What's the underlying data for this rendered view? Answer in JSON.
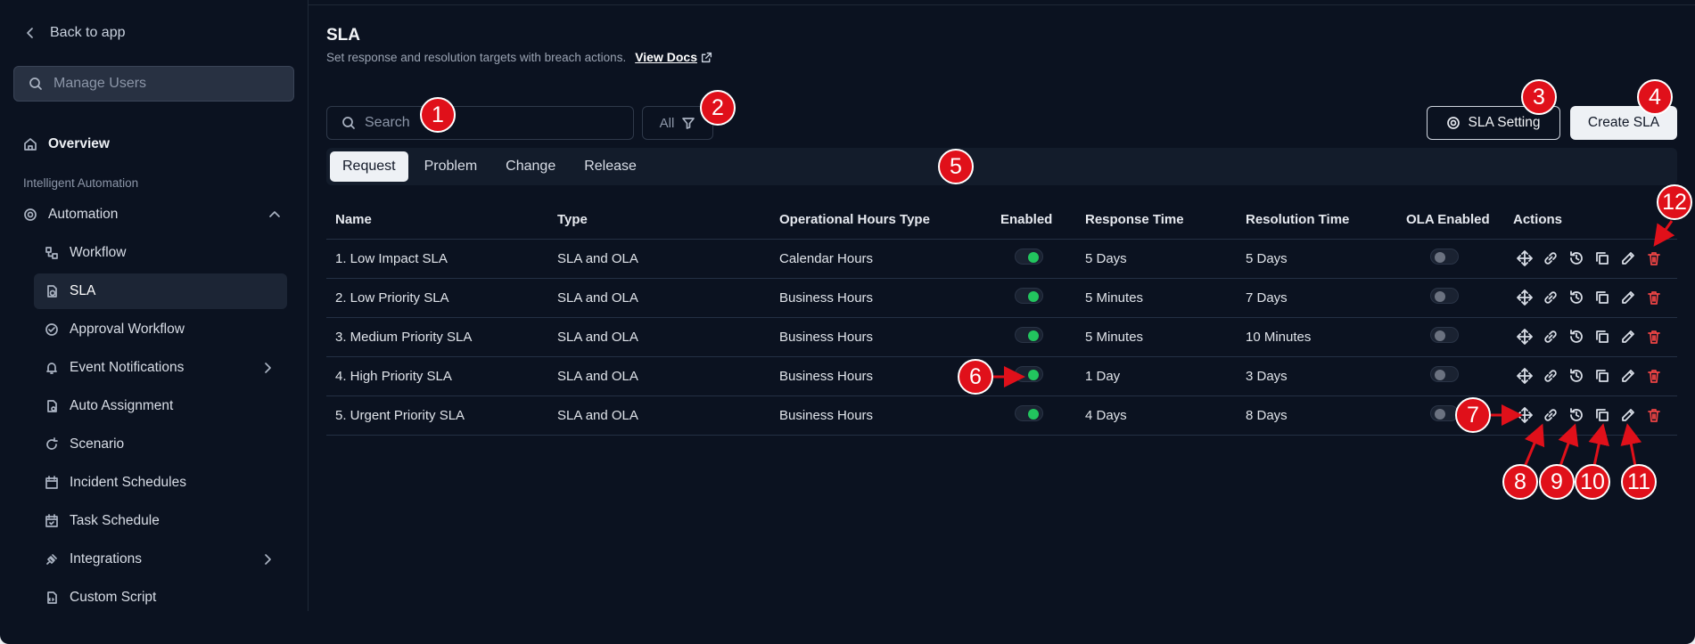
{
  "sidebar": {
    "back_label": "Back to app",
    "search_placeholder": "Manage Users",
    "overview": "Overview",
    "section": "Intelligent Automation",
    "automation": "Automation",
    "items": [
      {
        "label": "Workflow",
        "icon": "workflow-icon"
      },
      {
        "label": "SLA",
        "icon": "sla-icon"
      },
      {
        "label": "Approval Workflow",
        "icon": "check-circle-icon"
      },
      {
        "label": "Event Notifications",
        "icon": "bell-icon"
      },
      {
        "label": "Auto Assignment",
        "icon": "auto-assign-icon"
      },
      {
        "label": "Scenario",
        "icon": "refresh-icon"
      },
      {
        "label": "Incident Schedules",
        "icon": "calendar-icon"
      },
      {
        "label": "Task Schedule",
        "icon": "calendar-check-icon"
      },
      {
        "label": "Integrations",
        "icon": "plug-icon"
      },
      {
        "label": "Custom Script",
        "icon": "script-icon"
      }
    ]
  },
  "header": {
    "title": "SLA",
    "subtitle": "Set response and resolution targets with breach actions.",
    "docs_link": "View Docs"
  },
  "toolbar": {
    "search_placeholder": "Search",
    "filter_label": "All",
    "setting_label": "SLA Setting",
    "create_label": "Create SLA"
  },
  "tabs": [
    "Request",
    "Problem",
    "Change",
    "Release"
  ],
  "table": {
    "headers": [
      "Name",
      "Type",
      "Operational Hours Type",
      "Enabled",
      "Response Time",
      "Resolution Time",
      "OLA Enabled",
      "Actions"
    ],
    "rows": [
      {
        "name": "1. Low Impact SLA",
        "type": "SLA and OLA",
        "hours": "Calendar Hours",
        "enabled": true,
        "response": "5 Days",
        "resolution": "5 Days",
        "ola": false
      },
      {
        "name": "2. Low Priority SLA",
        "type": "SLA and OLA",
        "hours": "Business Hours",
        "enabled": true,
        "response": "5 Minutes",
        "resolution": "7 Days",
        "ola": false
      },
      {
        "name": "3. Medium Priority SLA",
        "type": "SLA and OLA",
        "hours": "Business Hours",
        "enabled": true,
        "response": "5 Minutes",
        "resolution": "10 Minutes",
        "ola": false
      },
      {
        "name": "4. High Priority SLA",
        "type": "SLA and OLA",
        "hours": "Business Hours",
        "enabled": true,
        "response": "1 Day",
        "resolution": "3 Days",
        "ola": false
      },
      {
        "name": "5. Urgent Priority SLA",
        "type": "SLA and OLA",
        "hours": "Business Hours",
        "enabled": true,
        "response": "4 Days",
        "resolution": "8 Days",
        "ola": false
      }
    ]
  },
  "annotations": [
    "1",
    "2",
    "3",
    "4",
    "5",
    "6",
    "7",
    "8",
    "9",
    "10",
    "11",
    "12"
  ],
  "colors": {
    "accent_green": "#22c55e",
    "delete_red": "#ef4444",
    "annotation_red": "#e0101a"
  }
}
